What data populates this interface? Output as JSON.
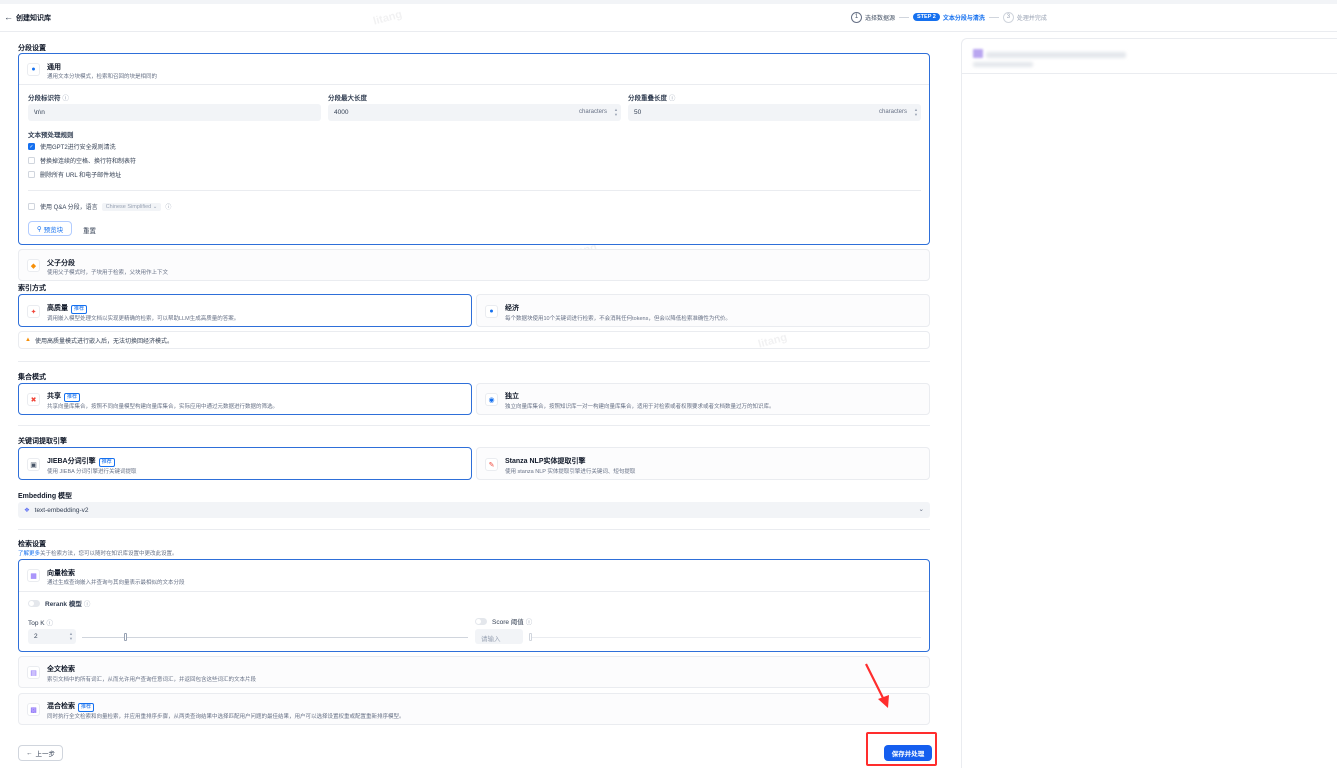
{
  "header": {
    "title": "创建知识库",
    "steps": [
      {
        "num": "1",
        "label": "选择数据源"
      },
      {
        "badge": "STEP 2",
        "label": "文本分段与清洗"
      },
      {
        "num": "3",
        "label": "处理并完成"
      }
    ]
  },
  "segment": {
    "section_title": "分段设置",
    "general": {
      "title": "通用",
      "desc": "通用文本分块模式，检索和召回的块是相同的"
    },
    "separator": {
      "label": "分段标识符",
      "value": "\\n\\n"
    },
    "max_len": {
      "label": "分段最大长度",
      "value": "4000",
      "unit": "characters"
    },
    "overlap": {
      "label": "分段重叠长度",
      "value": "50",
      "unit": "characters"
    },
    "rules_title": "文本预处理规则",
    "rules": [
      {
        "label": "使用GPT2进行安全规则清洗",
        "checked": true
      },
      {
        "label": "替换掉连续的空格、换行符和制表符",
        "checked": false
      },
      {
        "label": "删除所有 URL 和电子邮件地址",
        "checked": false
      }
    ],
    "qa_label": "使用 Q&A 分段，语言",
    "qa_lang": "Chinese Simplified",
    "preview_btn": "预览块",
    "reset_btn": "重置",
    "parent_child": {
      "title": "父子分段",
      "desc": "使用父子模式时，子块用于检索，父块用作上下文"
    }
  },
  "index": {
    "section_title": "索引方式",
    "high": {
      "title": "高质量",
      "badge": "推荐",
      "desc": "调用嵌入模型处理文档以实现更精确的检索，可以帮助LLM生成高质量的答案。"
    },
    "eco": {
      "title": "经济",
      "desc": "每个数据块使用10个关键词进行检索，不会消耗任何tokens，但会以降低检索准确性为代价。"
    },
    "warning": "使用高质量模式进行嵌入后，无法切换回经济模式。"
  },
  "collection": {
    "section_title": "集合模式",
    "shared": {
      "title": "共享",
      "badge": "推荐",
      "desc": "共享向量库集合，按照不同向量模型构建向量库集合，实际应用中通过元数据进行数据的筛选。"
    },
    "independent": {
      "title": "独立",
      "desc": "独立向量库集合，按照知识库一对一构建向量库集合，适用于对检索或者权限要求或者文档数量过万的知识库。"
    }
  },
  "keyword": {
    "section_title": "关键词提取引擎",
    "jieba": {
      "title": "JIEBA分词引擎",
      "badge": "推荐",
      "desc": "使用 JIEBA 分词引擎进行关键词提取"
    },
    "stanza": {
      "title": "Stanza NLP实体提取引擎",
      "desc": "使用 stanza NLP 实体提取引擎进行关键词、短句提取"
    }
  },
  "embedding": {
    "section_title": "Embedding 模型",
    "value": "text-embedding-v2"
  },
  "retrieval": {
    "section_title": "检索设置",
    "help_link": "了解更多",
    "help_text": "关于检索方法，您可以随时在知识库设置中更改此设置。",
    "vector": {
      "title": "向量检索",
      "desc": "通过生成查询嵌入并查询与其向量表示最相似的文本分段"
    },
    "rerank_label": "Rerank 模型",
    "topk_label": "Top K",
    "topk_value": "2",
    "score_label": "Score 阈值",
    "score_placeholder": "请输入",
    "fulltext": {
      "title": "全文检索",
      "desc": "索引文档中的所有词汇，从而允许用户查询任意词汇，并返回包含这些词汇的文本片段"
    },
    "hybrid": {
      "title": "混合检索",
      "badge": "推荐",
      "desc": "同时执行全文检索和向量检索，并应用重排序步骤，从两类查询结果中选择匹配用户问题的最佳结果，用户可以选择设置权重或配置重新排序模型。"
    }
  },
  "footer": {
    "prev_btn": "上一步",
    "save_btn": "保存并处理"
  },
  "watermark": "litang",
  "colors": {
    "primary": "#155eef",
    "selected_border": "#2e6fd9",
    "annotation": "#ff2d2d"
  }
}
